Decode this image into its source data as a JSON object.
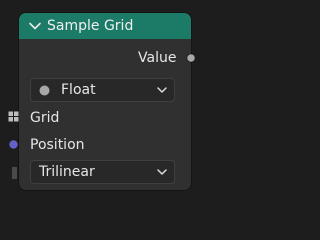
{
  "node": {
    "title": "Sample Grid",
    "header_color": "#1b7b67",
    "output_label": "Value",
    "data_type": "Float",
    "inputs": [
      {
        "label": "Grid",
        "socket_color": "#a8a8a8",
        "socket_icon": "grid-socket-icon"
      },
      {
        "label": "Position",
        "socket_color": "#6363c7",
        "socket_icon": "vector-socket-icon"
      }
    ],
    "interpolation": "Trilinear",
    "icons": {
      "collapse": "chevron-down-icon",
      "output_socket": "value-socket-icon",
      "data_type": "dot-icon",
      "dropdown": "chevron-down-icon"
    }
  }
}
